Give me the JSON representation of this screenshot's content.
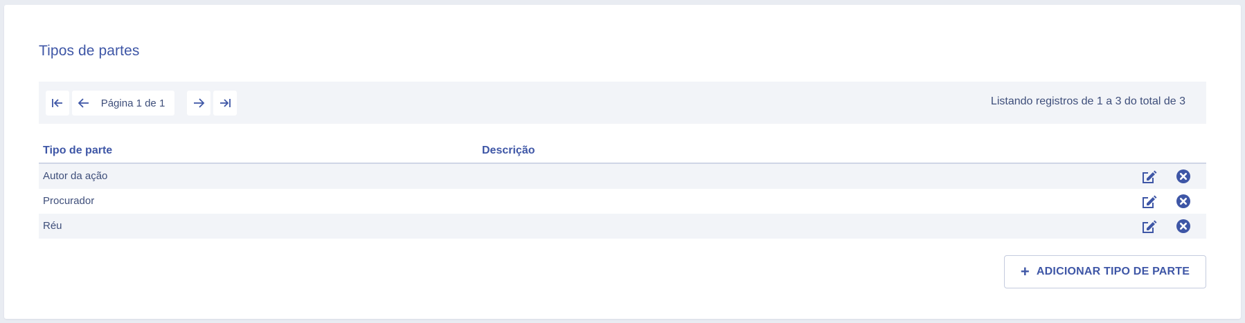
{
  "page": {
    "title": "Tipos de partes"
  },
  "pager": {
    "page_label": "Página 1 de 1",
    "info": "Listando registros de 1 a 3 do total de 3",
    "first_icon": "first-page-icon",
    "prev_icon": "arrow-left-icon",
    "next_icon": "arrow-right-icon",
    "last_icon": "last-page-icon"
  },
  "table": {
    "columns": [
      "Tipo de parte",
      "Descrição"
    ],
    "rows": [
      {
        "tipo": "Autor da ação",
        "descricao": ""
      },
      {
        "tipo": "Procurador",
        "descricao": ""
      },
      {
        "tipo": "Réu",
        "descricao": ""
      }
    ],
    "row_actions": {
      "edit_icon": "edit-icon",
      "delete_icon": "close-circle-icon"
    }
  },
  "actions": {
    "add_label": "ADICIONAR TIPO DE PARTE",
    "add_icon": "plus-icon"
  },
  "colors": {
    "accent": "#3e56a6",
    "text": "#3e4e7a",
    "stripe": "#f2f4f8",
    "background": "#e9ecf2"
  }
}
